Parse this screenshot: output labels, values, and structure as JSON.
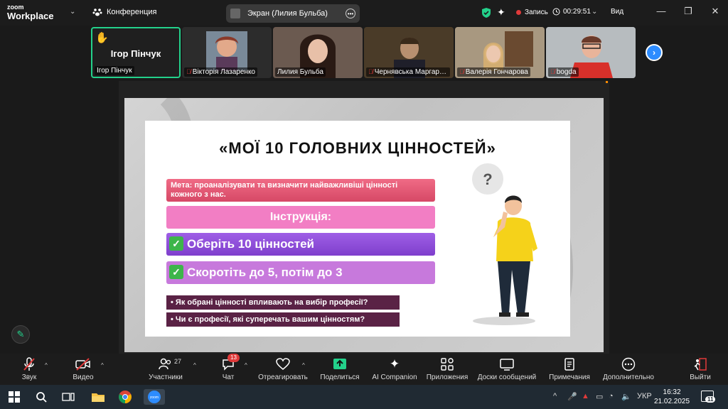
{
  "titlebar": {
    "logo_top": "zoom",
    "logo_bottom": "Workplace",
    "conference": "Конференция",
    "screen_share": "Экран (Лилия Бульба)",
    "record": "Запись",
    "timer": "00:29:51",
    "view": "Вид"
  },
  "gallery": {
    "tiles": [
      {
        "name": "Ігор Пінчук",
        "big_name": "Ігор Пінчук"
      },
      {
        "name": "Вікторія Лазаренко"
      },
      {
        "name": "Лилия Бульба"
      },
      {
        "name": "Чернявська Маргари..."
      },
      {
        "name": "Валерія Гончарова"
      },
      {
        "name": "bogda"
      }
    ]
  },
  "slide": {
    "title": "«МОЇ 10 ГОЛОВНИХ ЦІННОСТЕЙ»",
    "goal": "Мета: проаналізувати та визначити найважливіші цінності кожного з нас.",
    "instruction": "Інструкція:",
    "step1": "Оберіть 10 цінностей",
    "step2": "Скоротіть до 5, потім до 3",
    "question1": "• Як обрані цінності впливають на вибір професії?",
    "question2": "• Чи є професії, які суперечать вашим цінностям?",
    "check_mark": "✓",
    "bubble": "?"
  },
  "toolbar": {
    "audio": "Звук",
    "video": "Видео",
    "participants": "Участники",
    "participants_count": "27",
    "chat": "Чат",
    "chat_badge": "13",
    "react": "Отреагировать",
    "share": "Поделиться",
    "ai": "AI Companion",
    "apps": "Приложения",
    "boards": "Доски сообщений",
    "notes": "Примечания",
    "more": "Дополнительно",
    "leave": "Выйти"
  },
  "taskbar": {
    "lang": "УКР",
    "time": "16:32",
    "date": "21.02.2025",
    "notif_count": "11"
  },
  "colors": {
    "accent_green": "#23d18b",
    "zoom_blue": "#2d8cff",
    "record_red": "#e03a3a"
  }
}
